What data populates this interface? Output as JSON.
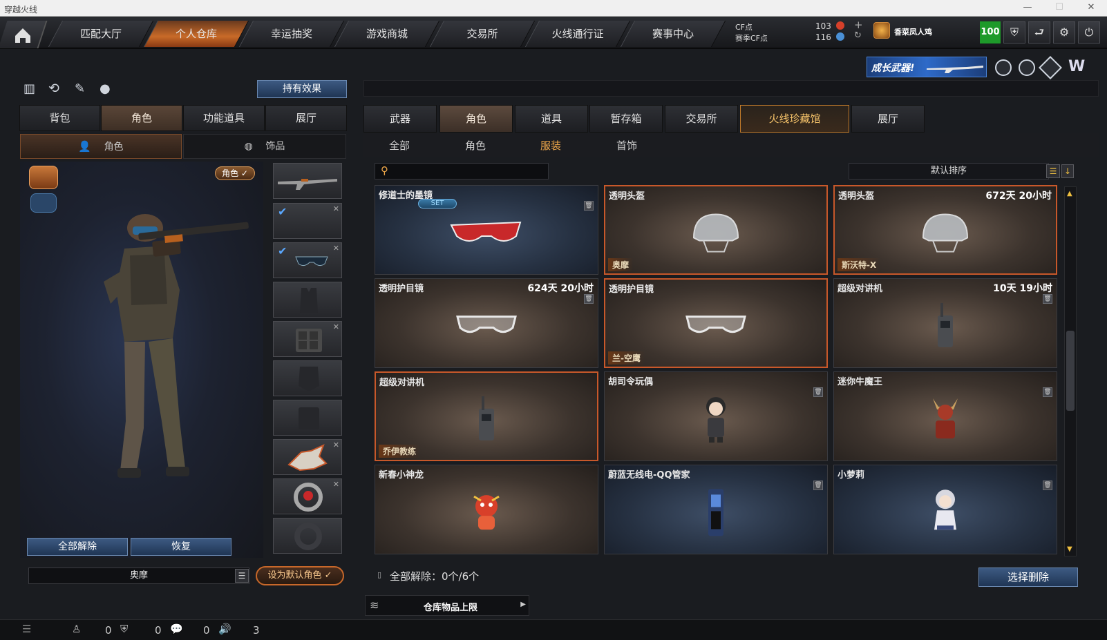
{
  "window": {
    "title": "穿越火线"
  },
  "topnav": {
    "tabs": [
      "匹配大厅",
      "个人仓库",
      "幸运抽奖",
      "游戏商城",
      "交易所",
      "火线通行证",
      "赛事中心"
    ],
    "active_index": 1,
    "cf_label": "CF点",
    "season_cf_label": "赛季CF点",
    "cf_value": "103",
    "season_cf_value": "116",
    "username": "香菜凤人鸡",
    "level": "100"
  },
  "banner": {
    "text": "成长武器!"
  },
  "left": {
    "hold_effect_button": "持有效果",
    "tabs": [
      "背包",
      "角色",
      "功能道具",
      "展厅"
    ],
    "active_tab": 1,
    "subtabs": [
      "角色",
      "饰品"
    ],
    "role_badge": "角色 ✓",
    "release_all": "全部解除",
    "restore": "恢复",
    "character_name": "奥摩",
    "set_default": "设为默认角色 ✓"
  },
  "right": {
    "tabs": [
      "武器",
      "角色",
      "道具",
      "暂存箱",
      "交易所",
      "火线珍藏馆",
      "展厅"
    ],
    "active_tab": 1,
    "categories": [
      "全部",
      "角色",
      "服装",
      "首饰"
    ],
    "active_category": 2,
    "search_placeholder": "",
    "sort_label": "默认排序",
    "items": [
      {
        "name": "修道士的墨镜",
        "time": "",
        "tag": "",
        "set": "SET",
        "style": "blue",
        "icon": "red-goggles-icon",
        "selected": false,
        "trash": true
      },
      {
        "name": "透明头盔",
        "time": "",
        "tag": "奥摩",
        "set": "",
        "style": "brown",
        "icon": "helmet-icon",
        "selected": true,
        "trash": false
      },
      {
        "name": "透明头盔",
        "time": "672天 20小时",
        "tag": "斯沃特-X",
        "set": "",
        "style": "brown",
        "icon": "helmet-icon",
        "selected": true,
        "trash": false
      },
      {
        "name": "透明护目镜",
        "time": "624天 20小时",
        "tag": "",
        "set": "",
        "style": "brown",
        "icon": "goggles-icon",
        "selected": false,
        "trash": true
      },
      {
        "name": "透明护目镜",
        "time": "",
        "tag": "兰-空鹰",
        "set": "",
        "style": "brown",
        "icon": "goggles-icon",
        "selected": true,
        "trash": false
      },
      {
        "name": "超级对讲机",
        "time": "10天 19小时",
        "tag": "",
        "set": "",
        "style": "brown",
        "icon": "walkie-talkie-icon",
        "selected": false,
        "trash": true
      },
      {
        "name": "超级对讲机",
        "time": "",
        "tag": "乔伊教练",
        "set": "",
        "style": "brown",
        "icon": "walkie-talkie-icon",
        "selected": true,
        "trash": false
      },
      {
        "name": "胡司令玩偶",
        "time": "",
        "tag": "",
        "set": "",
        "style": "brown",
        "icon": "doll-icon",
        "selected": false,
        "trash": true
      },
      {
        "name": "迷你牛魔王",
        "time": "",
        "tag": "",
        "set": "",
        "style": "brown",
        "icon": "bull-demon-icon",
        "selected": false,
        "trash": true
      },
      {
        "name": "新春小神龙",
        "time": "",
        "tag": "",
        "set": "",
        "style": "brown",
        "icon": "dragon-icon",
        "selected": false,
        "trash": false
      },
      {
        "name": "蔚蓝无线电-QQ管家",
        "time": "",
        "tag": "",
        "set": "",
        "style": "blue",
        "icon": "radio-icon",
        "selected": false,
        "trash": true
      },
      {
        "name": "小萝莉",
        "time": "",
        "tag": "",
        "set": "",
        "style": "blue",
        "icon": "girl-doll-icon",
        "selected": false,
        "trash": true
      }
    ],
    "release_all_status": "全部解除：0个/6个",
    "select_delete": "选择删除",
    "warehouse_limit": "仓库物品上限"
  },
  "statusbar": {
    "count1": "0",
    "count2": "0",
    "count3": "0",
    "count4": "3"
  }
}
